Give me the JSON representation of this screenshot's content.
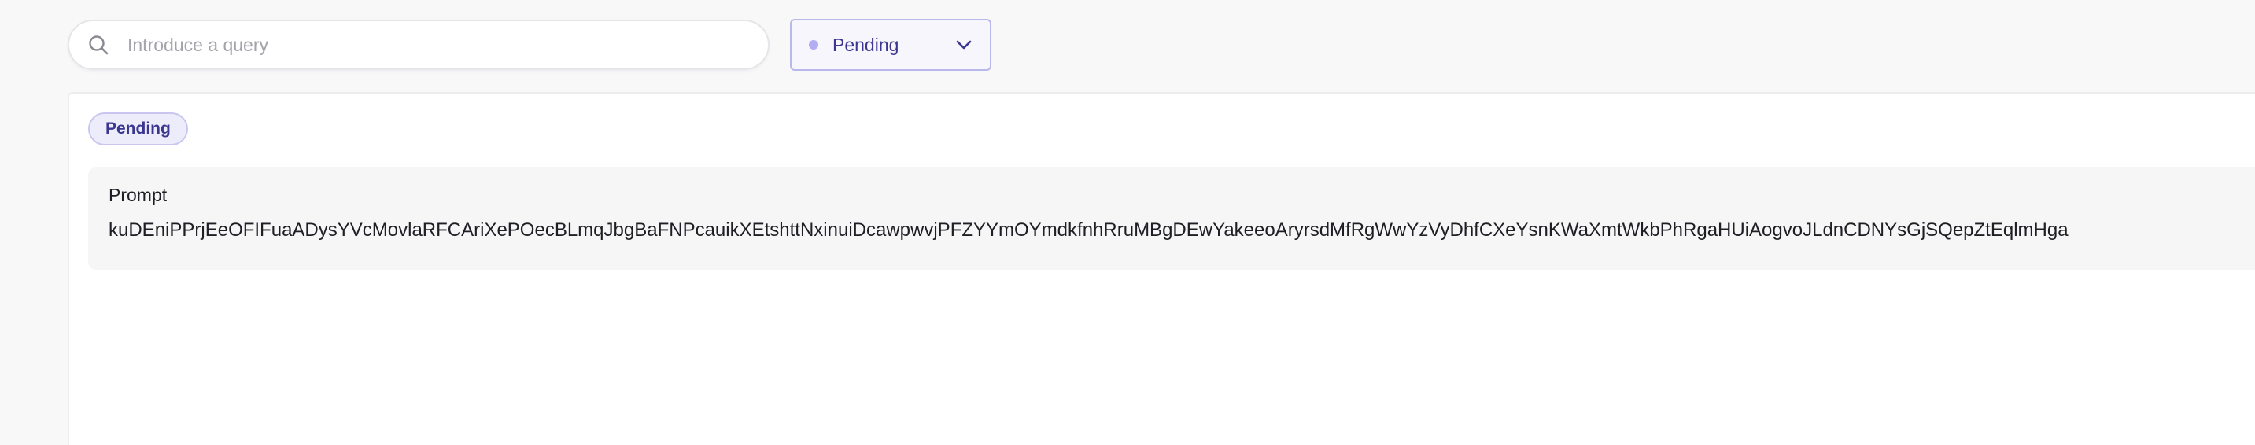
{
  "search": {
    "placeholder": "Introduce a query",
    "value": "",
    "icon": "search-icon"
  },
  "status_filter": {
    "selected": "Pending",
    "dot_color": "#b3adf2",
    "icon": "chevron-down-icon"
  },
  "record": {
    "status_badge": "Pending",
    "field_label": "Prompt",
    "field_value": "kuDEniPPrjEeOFIFuaADysYVcMovlaRFCAriXePOecBLmqJbgBaFNPcauikXEtshttNxinuiDcawpwvjPFZYYmOYmdkfnhRruMBgDEwYakeeoAryrsdMfRgWwYzVyDhfCXeYsnKWaXmtWkbPhRgaHUiAogvoJLdnCDNYsGjSQepZtEqlmHga"
  },
  "colors": {
    "accent": "#3b3790",
    "accent_border": "#b9b8ea",
    "badge_bg": "#ececfb"
  }
}
